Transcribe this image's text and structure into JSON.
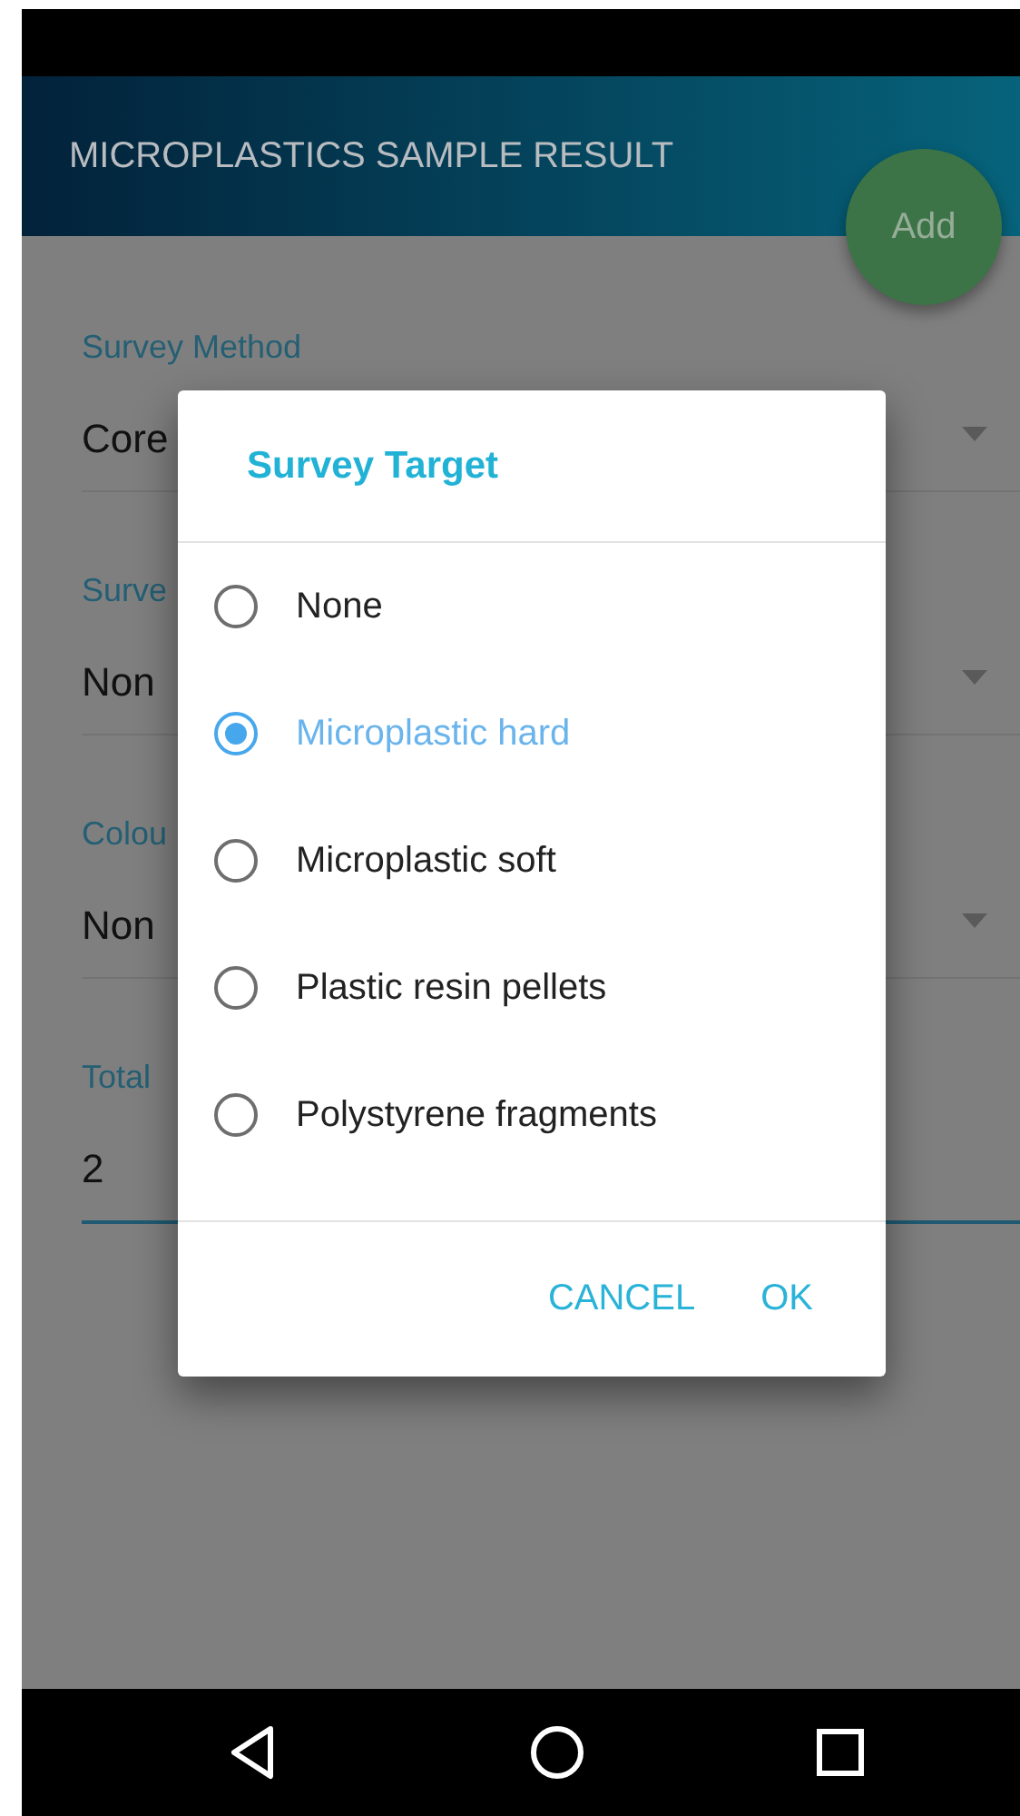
{
  "app_bar": {
    "title": "MICROPLASTICS SAMPLE RESULT"
  },
  "fab": {
    "label": "Add"
  },
  "fields": [
    {
      "kind": "dropdown",
      "label": "Survey Method",
      "value": "Core",
      "focused": false
    },
    {
      "kind": "dropdown",
      "label": "Surve",
      "value": "Non",
      "focused": false
    },
    {
      "kind": "dropdown",
      "label": "Colou",
      "value": "Non",
      "focused": false
    },
    {
      "kind": "text",
      "label": "Total",
      "value": "2",
      "focused": true
    }
  ],
  "dialog": {
    "title": "Survey Target",
    "options": [
      {
        "label": "None",
        "selected": false
      },
      {
        "label": "Microplastic hard",
        "selected": true
      },
      {
        "label": "Microplastic soft",
        "selected": false
      },
      {
        "label": "Plastic resin pellets",
        "selected": false
      },
      {
        "label": "Polystyrene fragments",
        "selected": false
      }
    ],
    "buttons": [
      "CANCEL",
      "OK"
    ]
  }
}
